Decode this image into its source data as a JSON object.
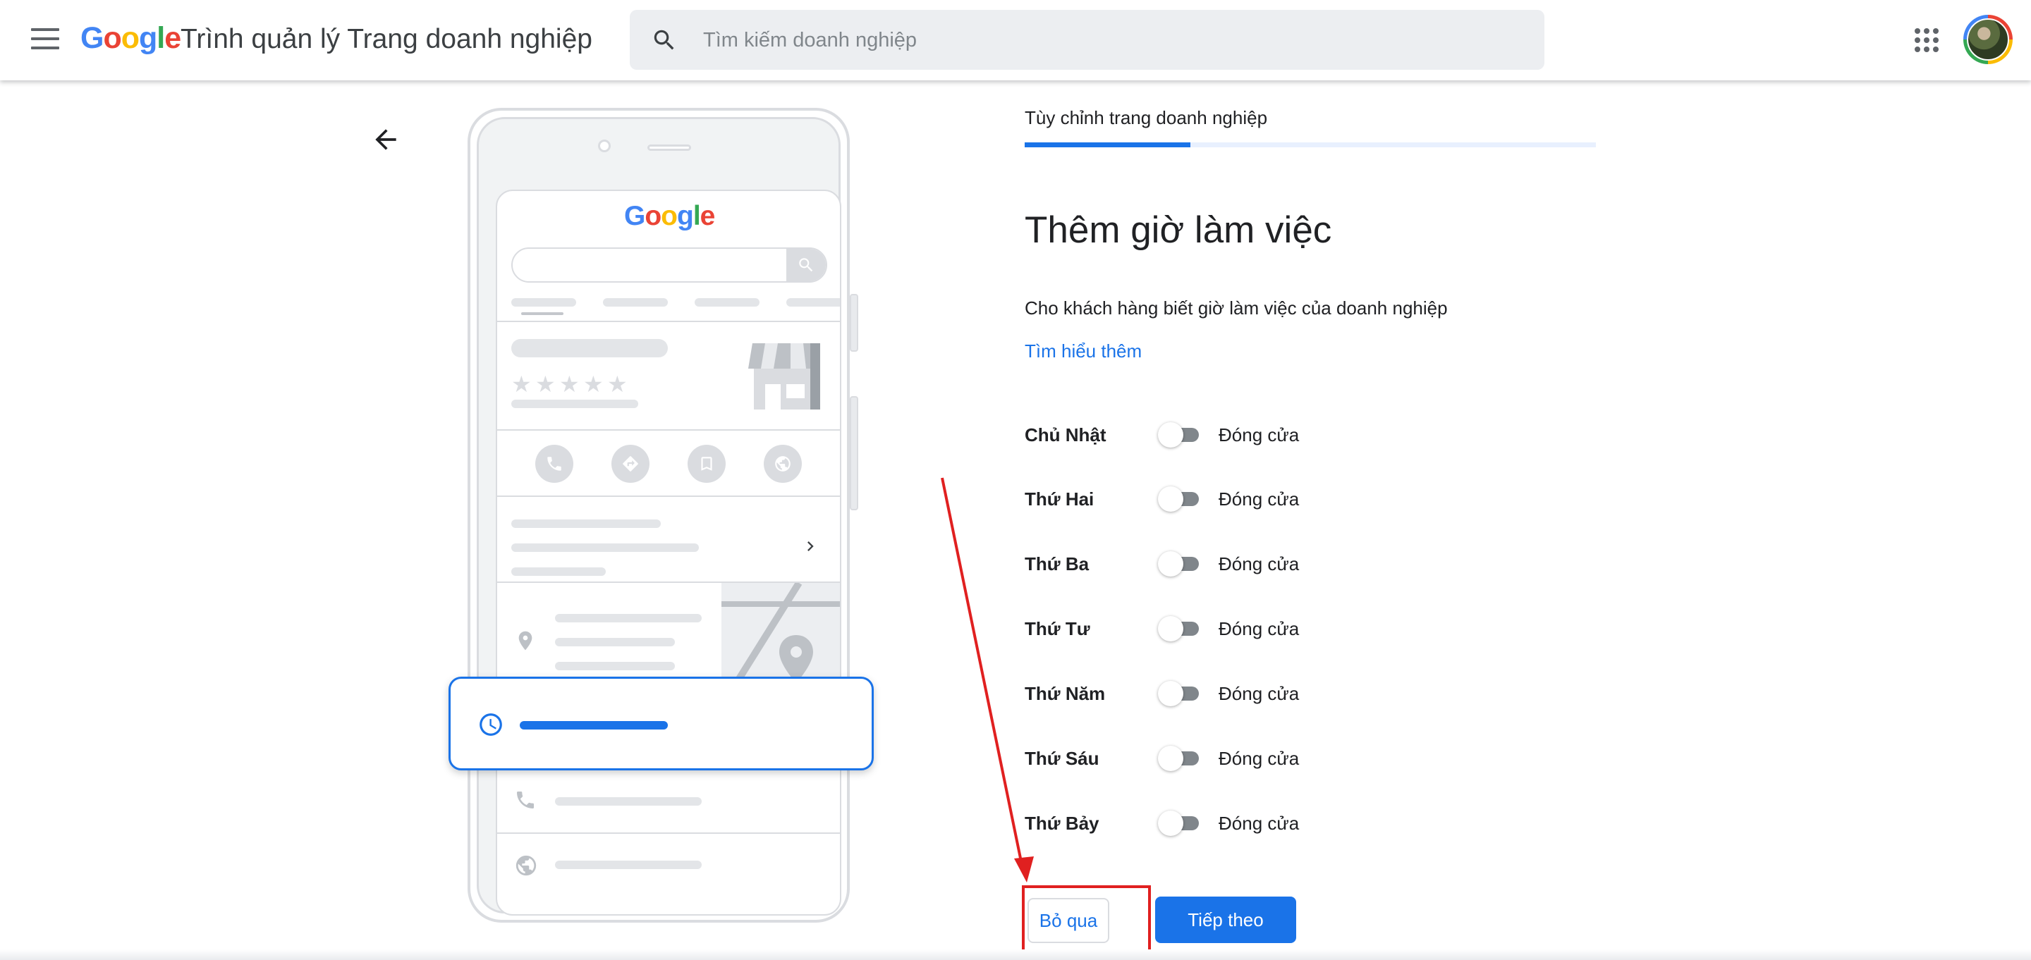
{
  "header": {
    "logo": [
      "G",
      "o",
      "o",
      "g",
      "l",
      "e"
    ],
    "app_title": "Trình quản lý Trang doanh nghiệp",
    "search_placeholder": "Tìm kiếm doanh nghiệp",
    "icons": [
      "menu-icon",
      "search-icon",
      "apps-grid-icon",
      "account-avatar"
    ]
  },
  "illustration": {
    "logo": [
      "G",
      "o",
      "o",
      "g",
      "l",
      "e"
    ],
    "icons": [
      "phone-icon",
      "directions-icon",
      "bookmark-icon",
      "globe-icon",
      "location-pin-icon",
      "clock-icon",
      "chevron-right-icon",
      "storefront-icon"
    ],
    "rating_stars": 5
  },
  "form": {
    "step_label": "Tùy chỉnh trang doanh nghiệp",
    "progress_fraction": 0.29,
    "title": "Thêm giờ làm việc",
    "description": "Cho khách hàng biết giờ làm việc của doanh nghiệp",
    "learn_more": "Tìm hiểu thêm",
    "days": [
      {
        "name": "Chủ Nhật",
        "status": "Đóng cửa",
        "open": false
      },
      {
        "name": "Thứ Hai",
        "status": "Đóng cửa",
        "open": false
      },
      {
        "name": "Thứ Ba",
        "status": "Đóng cửa",
        "open": false
      },
      {
        "name": "Thứ Tư",
        "status": "Đóng cửa",
        "open": false
      },
      {
        "name": "Thứ Năm",
        "status": "Đóng cửa",
        "open": false
      },
      {
        "name": "Thứ Sáu",
        "status": "Đóng cửa",
        "open": false
      },
      {
        "name": "Thứ Bảy",
        "status": "Đóng cửa",
        "open": false
      }
    ],
    "skip_label": "Bỏ qua",
    "next_label": "Tiếp theo"
  },
  "colors": {
    "accent": "#1a73e8",
    "annotation": "#e02020",
    "toggle_off": "#80868b"
  }
}
